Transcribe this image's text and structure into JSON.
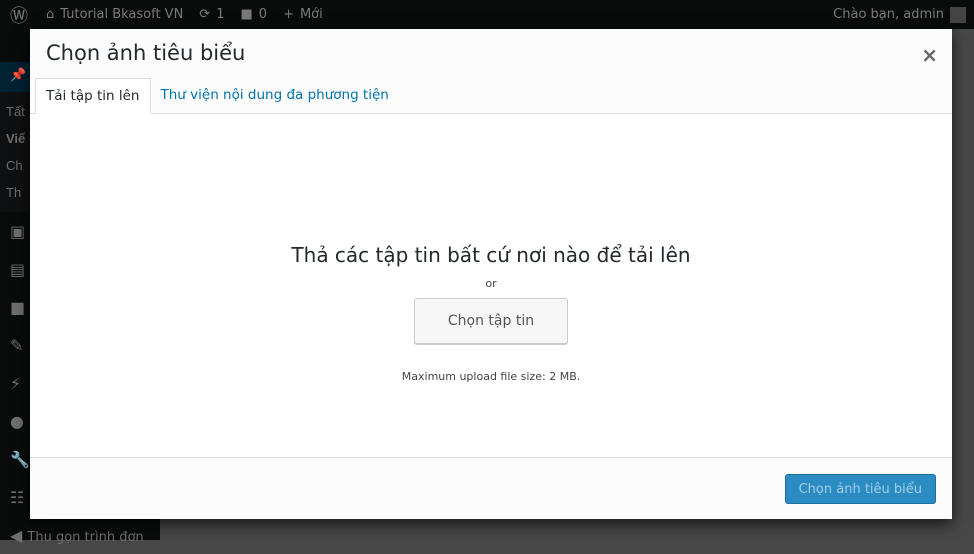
{
  "adminbar": {
    "site_name": "Tutorial Bkasoft VN",
    "updates": "1",
    "comments": "0",
    "new_label": "Mới",
    "greeting": "Chào bạn, admin"
  },
  "sidebar": {
    "submenu": [
      "Tất",
      "Viế",
      "Ch",
      "Th"
    ],
    "collapse_label": "Thu gọn trình đơn"
  },
  "modal": {
    "title": "Chọn ảnh tiêu biểu",
    "close": "×",
    "tabs": [
      {
        "label": "Tải tập tin lên",
        "active": true
      },
      {
        "label": "Thư viện nội dung đa phương tiện",
        "active": false
      }
    ],
    "drop_title": "Thả các tập tin bất cứ nơi nào để tải lên",
    "or": "or",
    "select_button": "Chọn tập tin",
    "max_size": "Maximum upload file size: 2 MB.",
    "footer_button": "Chọn ảnh tiêu biểu"
  },
  "colors": {
    "accent": "#2a8cc3",
    "adminbar": "#23282d"
  }
}
